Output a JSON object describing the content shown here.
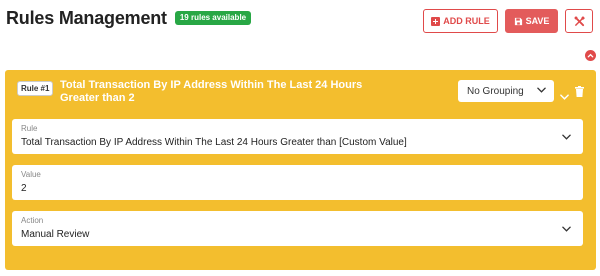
{
  "header": {
    "title": "Rules Management",
    "badge": "19 rules available"
  },
  "toolbar": {
    "add_label": "ADD RULE",
    "save_label": "SAVE"
  },
  "colors": {
    "brand_red": "#e04a4a",
    "rule_card": "#f3be2e",
    "badge_green": "#28a745"
  },
  "icons": {
    "add": "plus-square-icon",
    "save": "floppy-disk-icon",
    "tools": "tools-icon",
    "collapse": "chevron-up-circle-icon",
    "expand": "chevron-down-icon",
    "delete": "trash-icon"
  },
  "rule": {
    "tag": "Rule #1",
    "heading": "Total Transaction By IP Address Within The Last 24 Hours Greater than 2",
    "grouping": "No Grouping",
    "fields": {
      "rule": {
        "label": "Rule",
        "value": "Total Transaction By IP Address Within The Last 24 Hours Greater than [Custom Value]"
      },
      "value": {
        "label": "Value",
        "value": "2"
      },
      "action": {
        "label": "Action",
        "value": "Manual Review"
      }
    }
  }
}
